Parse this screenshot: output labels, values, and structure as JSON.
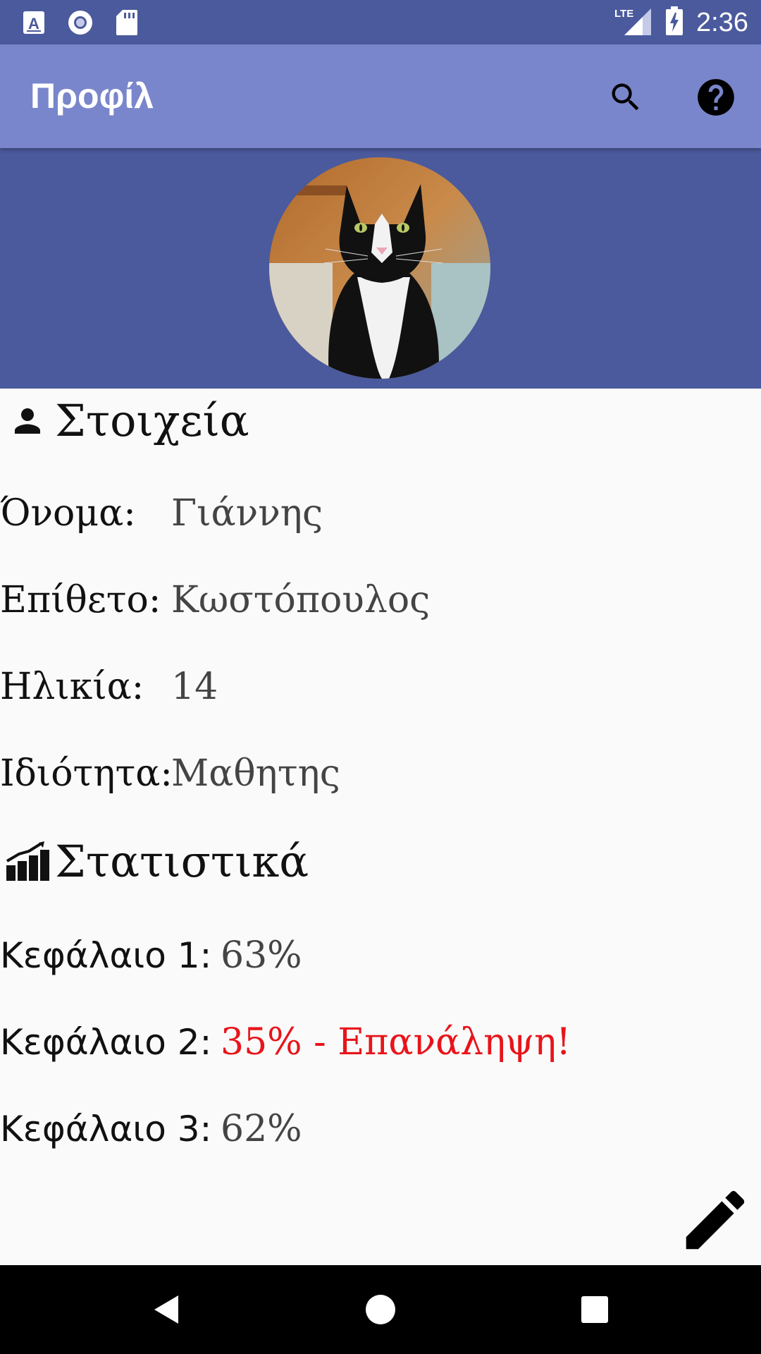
{
  "status_bar": {
    "time": "2:36",
    "network": "LTE",
    "icons": [
      "a-notification-icon",
      "circle-notification-icon",
      "sd-card-icon",
      "signal-icon",
      "battery-charging-icon"
    ]
  },
  "app_bar": {
    "title": "Προφίλ",
    "actions": [
      "search-icon",
      "help-icon"
    ]
  },
  "profile_photo": {
    "alt": "avatar"
  },
  "details": {
    "title": "Στοιχεία",
    "icon": "person-icon",
    "fields": [
      {
        "label": "Όνομα:",
        "value": "Γιάννης"
      },
      {
        "label": "Επίθετο:",
        "value": "Κωστόπουλος"
      },
      {
        "label": "Ηλικία:",
        "value": "14"
      },
      {
        "label": "Ιδιότητα:",
        "value": "Μαθητης"
      }
    ]
  },
  "stats": {
    "title": "Στατιστικά",
    "icon": "bar-chart-icon",
    "items": [
      {
        "label": "Κεφάλαιο 1:",
        "value": "63%"
      },
      {
        "label": "Κεφάλαιο 2:",
        "value": "35% - Επανάληψη!"
      },
      {
        "label": "Κεφάλαιο 3:",
        "value": "62%"
      }
    ]
  },
  "colors": {
    "primary_dark": "#4b5a9c",
    "primary": "#7986cb",
    "warning": "#e8141a"
  },
  "nav": [
    "back-icon",
    "home-icon",
    "recents-icon"
  ]
}
